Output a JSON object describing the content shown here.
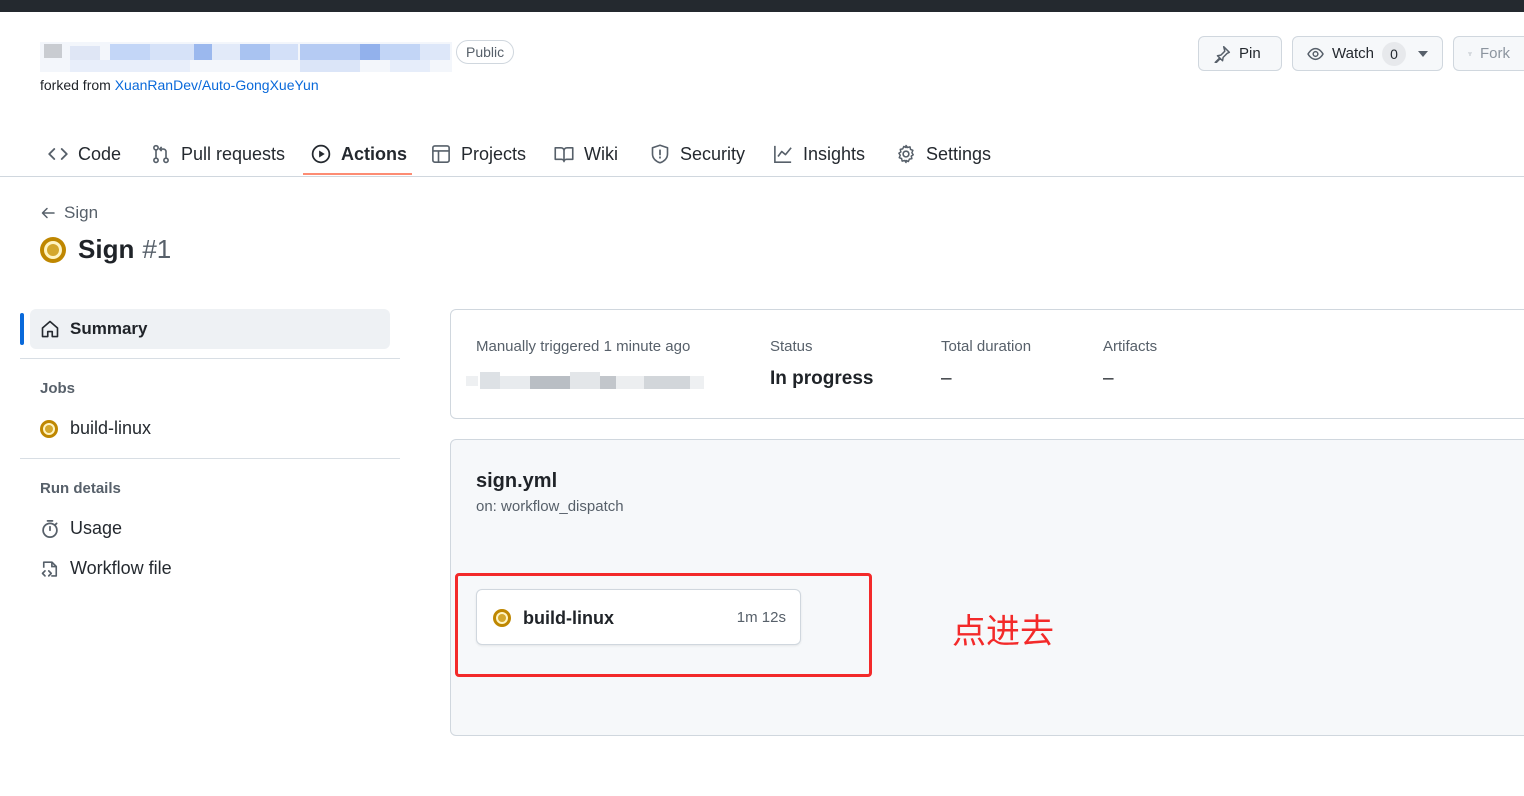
{
  "repo": {
    "visibility": "Public",
    "forked_prefix": "forked from ",
    "forked_source": "XuanRanDev/Auto-GongXueYun"
  },
  "header_buttons": {
    "pin_label": "Pin",
    "watch_label": "Watch",
    "watch_count": "0",
    "fork_label": "Fork"
  },
  "tabs": [
    {
      "label": "Code",
      "icon": "code-icon"
    },
    {
      "label": "Pull requests",
      "icon": "pull-request-icon"
    },
    {
      "label": "Actions",
      "icon": "play-icon",
      "active": true
    },
    {
      "label": "Projects",
      "icon": "table-icon"
    },
    {
      "label": "Wiki",
      "icon": "book-icon"
    },
    {
      "label": "Security",
      "icon": "shield-icon"
    },
    {
      "label": "Insights",
      "icon": "graph-icon"
    },
    {
      "label": "Settings",
      "icon": "gear-icon"
    }
  ],
  "run": {
    "back_label": "Sign",
    "title": "Sign",
    "number": "#1"
  },
  "sidebar": {
    "summary_label": "Summary",
    "jobs_heading": "Jobs",
    "jobs": [
      {
        "label": "build-linux",
        "status": "in_progress"
      }
    ],
    "run_details_heading": "Run details",
    "details": [
      {
        "label": "Usage",
        "icon": "stopwatch-icon"
      },
      {
        "label": "Workflow file",
        "icon": "file-code-icon"
      }
    ]
  },
  "summary": {
    "trigger_text": "Manually triggered 1 minute ago",
    "status_label": "Status",
    "status_value": "In progress",
    "duration_label": "Total duration",
    "duration_value": "–",
    "artifacts_label": "Artifacts",
    "artifacts_value": "–"
  },
  "workflow": {
    "file": "sign.yml",
    "trigger": "on: workflow_dispatch",
    "job": {
      "name": "build-linux",
      "duration": "1m 12s",
      "status": "in_progress"
    }
  },
  "annotation": {
    "text": "点进去",
    "color": "#f32a2a"
  },
  "colors": {
    "accent": "#0969da",
    "in_progress": "#bf8700",
    "tab_underline": "#fd8c73"
  }
}
